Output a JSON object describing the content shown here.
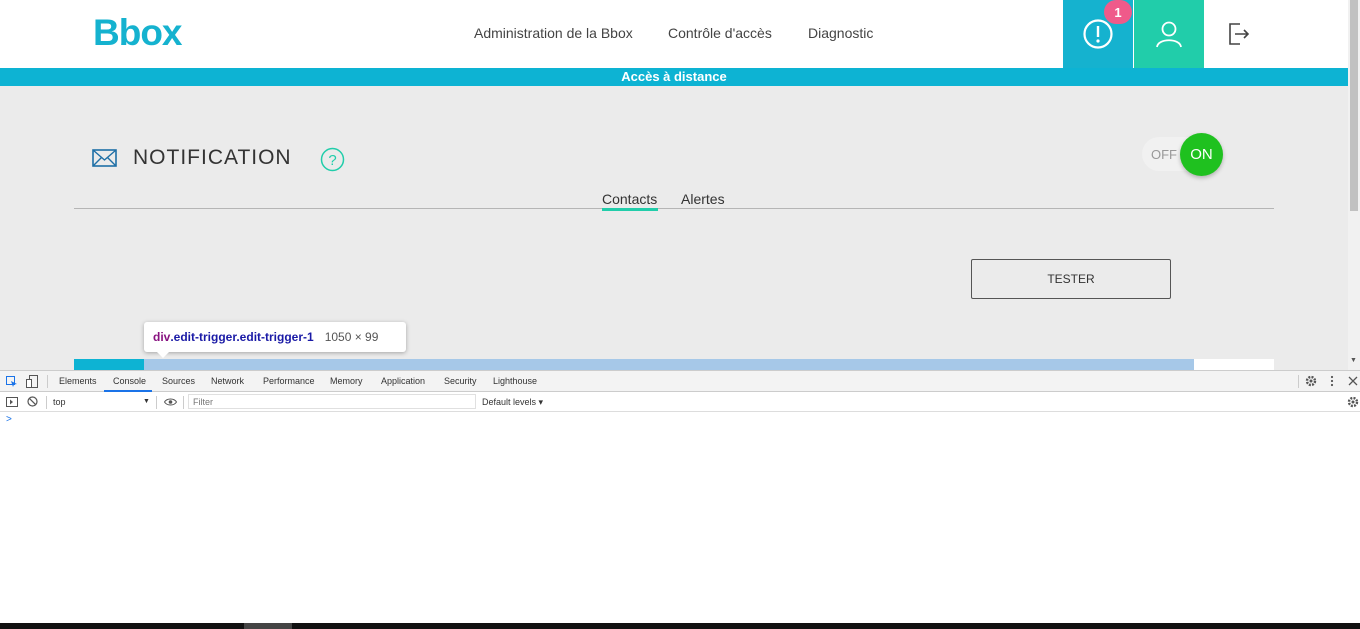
{
  "header": {
    "logo": "Bbox",
    "nav": [
      "Administration de la Bbox",
      "Contrôle d'accès",
      "Diagnostic"
    ],
    "alert_badge": "1",
    "icons": [
      "alert-icon",
      "user-icon",
      "logout-icon"
    ]
  },
  "banner": {
    "text": "Accès à distance"
  },
  "notification": {
    "title": "NOTIFICATION",
    "toggle_off": "OFF",
    "toggle_on": "ON",
    "tabs": [
      "Contacts",
      "Alertes"
    ],
    "active_tab": "Contacts",
    "tester_label": "TESTER"
  },
  "inspector_tooltip": {
    "tag": "div",
    "classes": ".edit-trigger.edit-trigger-1",
    "size": "1050 × 99"
  },
  "devtools": {
    "tabs": [
      "Elements",
      "Console",
      "Sources",
      "Network",
      "Performance",
      "Memory",
      "Application",
      "Security",
      "Lighthouse"
    ],
    "active_tab": "Console",
    "context": "top",
    "filter_placeholder": "Filter",
    "levels": "Default levels ▾",
    "prompt": ">"
  },
  "colors": {
    "brand_cyan": "#15b2cf",
    "brand_green": "#21cdaa",
    "toggle_on": "#1fc11f",
    "badge_pink": "#ef5a8a"
  }
}
